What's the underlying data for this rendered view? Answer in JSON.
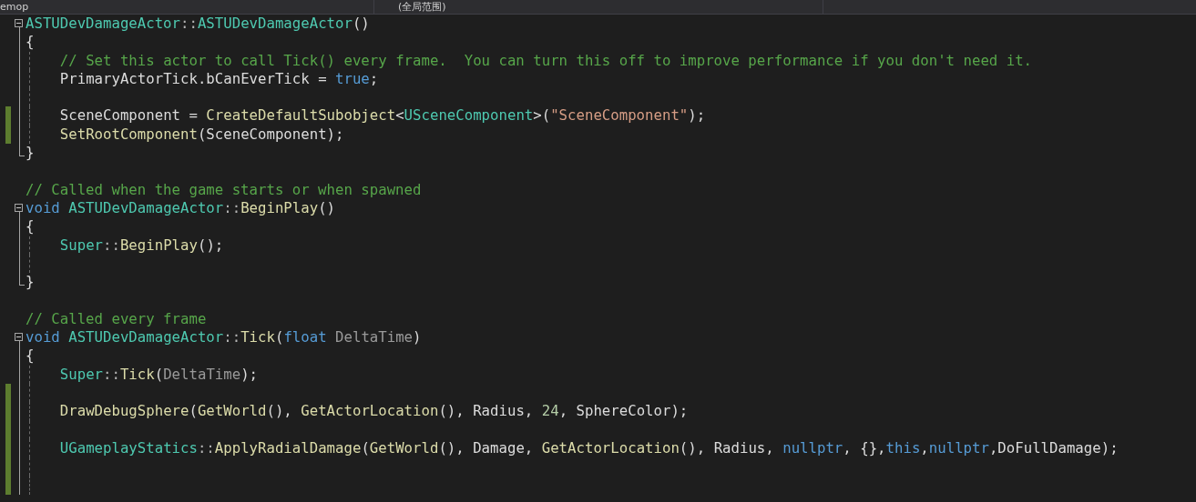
{
  "top_bar": {
    "tabs": [
      {
        "label": "emop"
      },
      {
        "label": "(全局范围)"
      }
    ]
  },
  "lines": [
    {
      "kind": "code",
      "fold_start": true,
      "tokens": [
        {
          "text": "ASTUDevDamageActor",
          "kind": "type"
        },
        {
          "text": "::",
          "kind": "punct"
        },
        {
          "text": "ASTUDevDamageActor",
          "kind": "type"
        },
        {
          "text": "()",
          "kind": "plain"
        }
      ]
    },
    {
      "kind": "code",
      "in_fold": true,
      "tokens": [
        {
          "text": "{",
          "kind": "plain"
        }
      ]
    },
    {
      "kind": "code",
      "in_fold": true,
      "indented": true,
      "tokens": [
        {
          "text": "// Set this actor to call Tick() every frame.  You can turn this off to improve performance if you don't need it.",
          "kind": "comment"
        }
      ]
    },
    {
      "kind": "code",
      "in_fold": true,
      "indented": true,
      "tokens": [
        {
          "text": "PrimaryActorTick.bCanEverTick = ",
          "kind": "plain"
        },
        {
          "text": "true",
          "kind": "keyword"
        },
        {
          "text": ";",
          "kind": "plain"
        }
      ]
    },
    {
      "kind": "blank",
      "in_fold": true
    },
    {
      "kind": "code",
      "in_fold": true,
      "indented": true,
      "changed": true,
      "tokens": [
        {
          "text": "SceneComponent = ",
          "kind": "plain"
        },
        {
          "text": "CreateDefaultSubobject",
          "kind": "function"
        },
        {
          "text": "<",
          "kind": "plain"
        },
        {
          "text": "USceneComponent",
          "kind": "type"
        },
        {
          "text": ">(",
          "kind": "plain"
        },
        {
          "text": "\"SceneComponent\"",
          "kind": "string"
        },
        {
          "text": ");",
          "kind": "plain"
        }
      ]
    },
    {
      "kind": "code",
      "in_fold": true,
      "indented": true,
      "changed": true,
      "tokens": [
        {
          "text": "SetRootComponent",
          "kind": "function"
        },
        {
          "text": "(SceneComponent);",
          "kind": "plain"
        }
      ]
    },
    {
      "kind": "code",
      "fold_end": true,
      "tokens": [
        {
          "text": "}",
          "kind": "plain"
        }
      ]
    },
    {
      "kind": "blank"
    },
    {
      "kind": "code",
      "tokens": [
        {
          "text": "// Called when the game starts or when spawned",
          "kind": "comment"
        }
      ]
    },
    {
      "kind": "code",
      "fold_start": true,
      "tokens": [
        {
          "text": "void ",
          "kind": "keyword"
        },
        {
          "text": "ASTUDevDamageActor",
          "kind": "type"
        },
        {
          "text": "::",
          "kind": "punct"
        },
        {
          "text": "BeginPlay",
          "kind": "function"
        },
        {
          "text": "()",
          "kind": "plain"
        }
      ]
    },
    {
      "kind": "code",
      "in_fold": true,
      "tokens": [
        {
          "text": "{",
          "kind": "plain"
        }
      ]
    },
    {
      "kind": "code",
      "in_fold": true,
      "indented": true,
      "tokens": [
        {
          "text": "Super",
          "kind": "type"
        },
        {
          "text": "::",
          "kind": "punct"
        },
        {
          "text": "BeginPlay",
          "kind": "function"
        },
        {
          "text": "();",
          "kind": "plain"
        }
      ]
    },
    {
      "kind": "blank",
      "in_fold": true
    },
    {
      "kind": "code",
      "fold_end": true,
      "tokens": [
        {
          "text": "}",
          "kind": "plain"
        }
      ]
    },
    {
      "kind": "blank"
    },
    {
      "kind": "code",
      "tokens": [
        {
          "text": "// Called every frame",
          "kind": "comment"
        }
      ]
    },
    {
      "kind": "code",
      "fold_start": true,
      "tokens": [
        {
          "text": "void ",
          "kind": "keyword"
        },
        {
          "text": "ASTUDevDamageActor",
          "kind": "type"
        },
        {
          "text": "::",
          "kind": "punct"
        },
        {
          "text": "Tick",
          "kind": "function"
        },
        {
          "text": "(",
          "kind": "plain"
        },
        {
          "text": "float",
          "kind": "keyword"
        },
        {
          "text": " DeltaTime",
          "kind": "param"
        },
        {
          "text": ")",
          "kind": "plain"
        }
      ]
    },
    {
      "kind": "code",
      "in_fold": true,
      "tokens": [
        {
          "text": "{",
          "kind": "plain"
        }
      ]
    },
    {
      "kind": "code",
      "in_fold": true,
      "indented": true,
      "tokens": [
        {
          "text": "Super",
          "kind": "type"
        },
        {
          "text": "::",
          "kind": "punct"
        },
        {
          "text": "Tick",
          "kind": "function"
        },
        {
          "text": "(",
          "kind": "plain"
        },
        {
          "text": "DeltaTime",
          "kind": "param"
        },
        {
          "text": ");",
          "kind": "plain"
        }
      ]
    },
    {
      "kind": "blank",
      "in_fold": true,
      "changed": true
    },
    {
      "kind": "code",
      "in_fold": true,
      "indented": true,
      "changed": true,
      "tokens": [
        {
          "text": "DrawDebugSphere",
          "kind": "function"
        },
        {
          "text": "(",
          "kind": "plain"
        },
        {
          "text": "GetWorld",
          "kind": "function"
        },
        {
          "text": "(), ",
          "kind": "plain"
        },
        {
          "text": "GetActorLocation",
          "kind": "function"
        },
        {
          "text": "(), Radius, ",
          "kind": "plain"
        },
        {
          "text": "24",
          "kind": "number"
        },
        {
          "text": ", SphereColor);",
          "kind": "plain"
        }
      ]
    },
    {
      "kind": "blank",
      "in_fold": true,
      "changed": true
    },
    {
      "kind": "code",
      "in_fold": true,
      "indented": true,
      "changed": true,
      "tokens": [
        {
          "text": "UGameplayStatics",
          "kind": "type"
        },
        {
          "text": "::",
          "kind": "punct"
        },
        {
          "text": "ApplyRadialDamage",
          "kind": "function"
        },
        {
          "text": "(",
          "kind": "plain"
        },
        {
          "text": "GetWorld",
          "kind": "function"
        },
        {
          "text": "(), Damage, ",
          "kind": "plain"
        },
        {
          "text": "GetActorLocation",
          "kind": "function"
        },
        {
          "text": "(), Radius, ",
          "kind": "plain"
        },
        {
          "text": "nullptr",
          "kind": "keyword"
        },
        {
          "text": ", {},",
          "kind": "plain"
        },
        {
          "text": "this",
          "kind": "keyword"
        },
        {
          "text": ",",
          "kind": "plain"
        },
        {
          "text": "nullptr",
          "kind": "keyword"
        },
        {
          "text": ",DoFullDamage);",
          "kind": "plain"
        }
      ]
    },
    {
      "kind": "blank",
      "in_fold": true,
      "changed": true
    },
    {
      "kind": "blank",
      "in_fold": true,
      "changed": true
    }
  ]
}
